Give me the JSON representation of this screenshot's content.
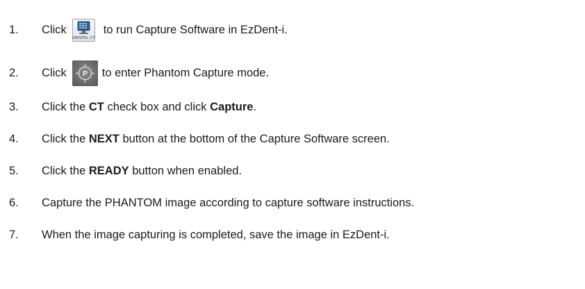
{
  "steps": [
    {
      "number": "1.",
      "before": "Click",
      "icon": "dental-ct-icon",
      "icon_label": "DENTAL CT",
      "after": "to run Capture Software in EzDent-i."
    },
    {
      "number": "2.",
      "before": "Click",
      "icon": "phantom-capture-icon",
      "icon_letter": "P",
      "after": "to enter Phantom Capture mode."
    },
    {
      "number": "3.",
      "p1": "Click the ",
      "b1": "CT",
      "p2": " check box and click ",
      "b2": "Capture",
      "p3": "."
    },
    {
      "number": "4.",
      "p1": "Click the ",
      "b1": "NEXT",
      "p2": " button at the bottom of the Capture Software screen."
    },
    {
      "number": "5.",
      "p1": "Click the ",
      "b1": "READY",
      "p2": " button when enabled."
    },
    {
      "number": "6.",
      "text": "Capture the PHANTOM image according to capture software instructions."
    },
    {
      "number": "7.",
      "text": "When the image capturing is completed, save the image in EzDent-i."
    }
  ],
  "colors": {
    "text": "#1a1a1a",
    "phantom_icon_bg": "#6c6c6c",
    "dental_icon_screen": "#2f5d8a"
  }
}
